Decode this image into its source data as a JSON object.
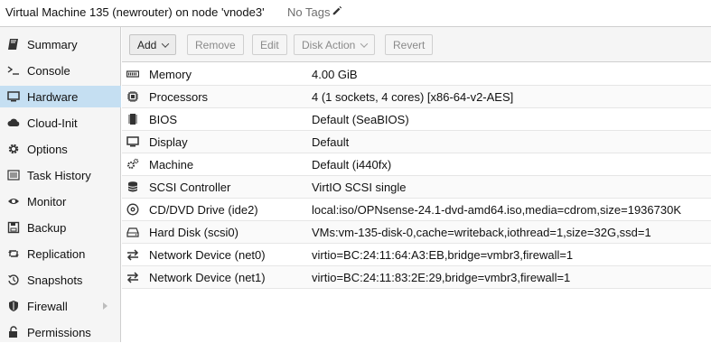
{
  "header": {
    "title": "Virtual Machine 135 (newrouter) on node 'vnode3'",
    "tags": "No Tags"
  },
  "sidebar": {
    "items": [
      {
        "label": "Summary",
        "icon": "book-icon"
      },
      {
        "label": "Console",
        "icon": "terminal-icon"
      },
      {
        "label": "Hardware",
        "icon": "monitor-icon",
        "active": true
      },
      {
        "label": "Cloud-Init",
        "icon": "cloud-icon"
      },
      {
        "label": "Options",
        "icon": "gear-icon"
      },
      {
        "label": "Task History",
        "icon": "list-icon"
      },
      {
        "label": "Monitor",
        "icon": "eye-icon"
      },
      {
        "label": "Backup",
        "icon": "floppy-icon"
      },
      {
        "label": "Replication",
        "icon": "retweet-icon"
      },
      {
        "label": "Snapshots",
        "icon": "history-icon"
      },
      {
        "label": "Firewall",
        "icon": "shield-icon"
      },
      {
        "label": "Permissions",
        "icon": "unlock-icon"
      }
    ]
  },
  "toolbar": {
    "add": "Add",
    "remove": "Remove",
    "edit": "Edit",
    "disk_action": "Disk Action",
    "revert": "Revert"
  },
  "hardware": {
    "rows": [
      {
        "name": "Memory",
        "value": "4.00 GiB",
        "icon": "memory-icon"
      },
      {
        "name": "Processors",
        "value": "4 (1 sockets, 4 cores) [x86-64-v2-AES]",
        "icon": "cpu-icon"
      },
      {
        "name": "BIOS",
        "value": "Default (SeaBIOS)",
        "icon": "microchip-icon"
      },
      {
        "name": "Display",
        "value": "Default",
        "icon": "desktop-icon"
      },
      {
        "name": "Machine",
        "value": "Default (i440fx)",
        "icon": "cogs-icon"
      },
      {
        "name": "SCSI Controller",
        "value": "VirtIO SCSI single",
        "icon": "database-icon"
      },
      {
        "name": "CD/DVD Drive (ide2)",
        "value": "local:iso/OPNsense-24.1-dvd-amd64.iso,media=cdrom,size=1936730K",
        "icon": "cdrom-icon"
      },
      {
        "name": "Hard Disk (scsi0)",
        "value": "VMs:vm-135-disk-0,cache=writeback,iothread=1,size=32G,ssd=1",
        "icon": "hdd-icon"
      },
      {
        "name": "Network Device (net0)",
        "value": "virtio=BC:24:11:64:A3:EB,bridge=vmbr3,firewall=1",
        "icon": "exchange-icon"
      },
      {
        "name": "Network Device (net1)",
        "value": "virtio=BC:24:11:83:2E:29,bridge=vmbr3,firewall=1",
        "icon": "exchange-icon"
      }
    ]
  }
}
